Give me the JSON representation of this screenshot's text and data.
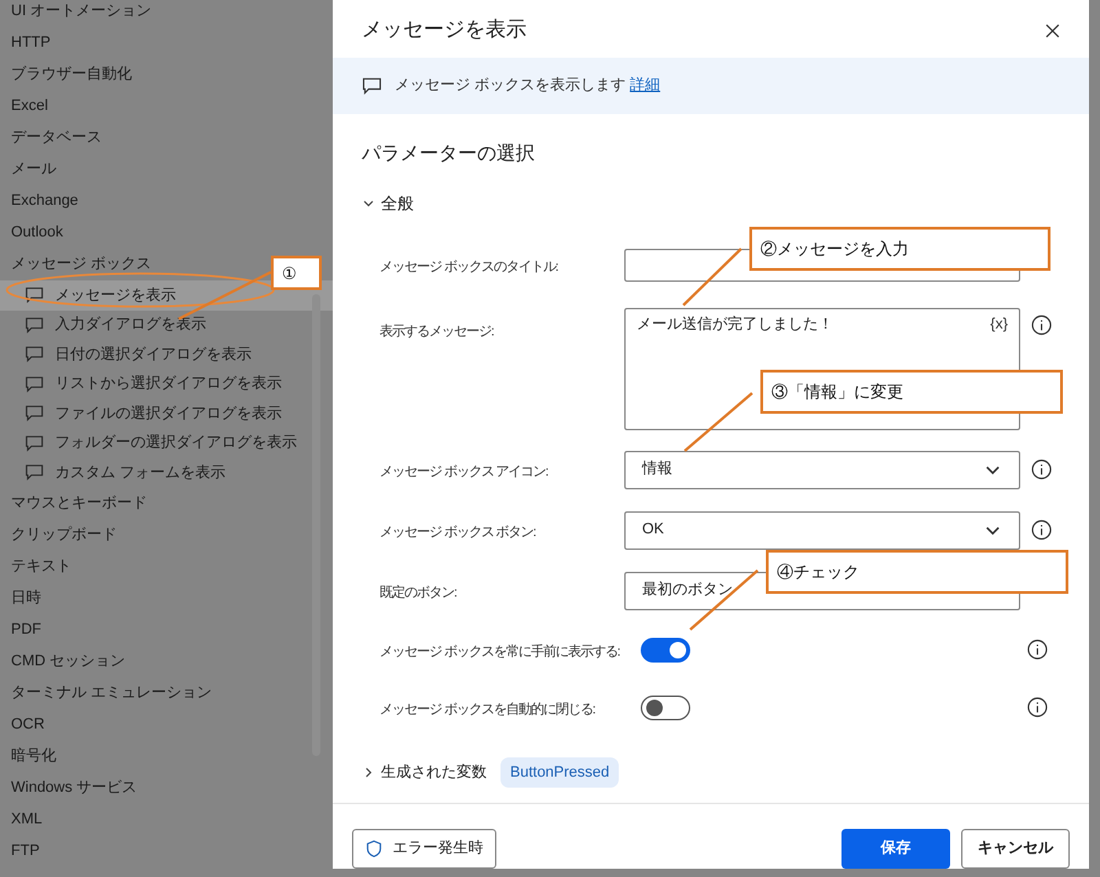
{
  "sidebar": {
    "items": [
      {
        "label": "UI オートメーション"
      },
      {
        "label": "HTTP"
      },
      {
        "label": "ブラウザー自動化"
      },
      {
        "label": "Excel"
      },
      {
        "label": "データベース"
      },
      {
        "label": "メール"
      },
      {
        "label": "Exchange"
      },
      {
        "label": "Outlook"
      },
      {
        "label": "メッセージ ボックス",
        "children": [
          {
            "label": "メッセージを表示",
            "selected": true
          },
          {
            "label": "入力ダイアログを表示",
            "selected": false
          },
          {
            "label": "日付の選択ダイアログを表示",
            "selected": false
          },
          {
            "label": "リストから選択ダイアログを表示",
            "selected": false
          },
          {
            "label": "ファイルの選択ダイアログを表示",
            "selected": false
          },
          {
            "label": "フォルダーの選択ダイアログを表示",
            "selected": false
          },
          {
            "label": "カスタム フォームを表示",
            "selected": false
          }
        ]
      },
      {
        "label": "マウスとキーボード"
      },
      {
        "label": "クリップボード"
      },
      {
        "label": "テキスト"
      },
      {
        "label": "日時"
      },
      {
        "label": "PDF"
      },
      {
        "label": "CMD セッション"
      },
      {
        "label": "ターミナル エミュレーション"
      },
      {
        "label": "OCR"
      },
      {
        "label": "暗号化"
      },
      {
        "label": "Windows サービス"
      },
      {
        "label": "XML"
      },
      {
        "label": "FTP"
      }
    ]
  },
  "dialog": {
    "title": "メッセージを表示",
    "description": "メッセージ ボックスを表示します",
    "details_link": "詳細",
    "section_title": "パラメーターの選択",
    "group": {
      "label": "全般",
      "expanded": true
    },
    "fields": [
      {
        "kind": "text",
        "label": "メッセージ ボックスのタイトル:"
      },
      {
        "kind": "textarea",
        "label": "表示するメッセージ:",
        "value": "メール送信が完了しました！",
        "variable_button": "{x}"
      },
      {
        "kind": "dropdown",
        "label": "メッセージ ボックス アイコン:",
        "value": "情報"
      },
      {
        "kind": "dropdown",
        "label": "メッセージ ボックス ボタン:",
        "value": "OK"
      },
      {
        "kind": "dropdown",
        "label": "既定のボタン:",
        "value": "最初のボタン"
      },
      {
        "kind": "toggle",
        "label": "メッセージ ボックスを常に手前に表示する:",
        "on": true
      },
      {
        "kind": "toggle",
        "label": "メッセージ ボックスを自動的に閉じる:",
        "on": false
      }
    ],
    "variables": {
      "label": "生成された変数",
      "expanded": false,
      "tag": "ButtonPressed"
    },
    "footer": {
      "error_button": "エラー発生時",
      "save": "保存",
      "cancel": "キャンセル"
    }
  },
  "annotations": [
    {
      "label": "①"
    },
    {
      "label": "②メッセージを入力"
    },
    {
      "label": "③「情報」に変更"
    },
    {
      "label": "④チェック"
    }
  ]
}
